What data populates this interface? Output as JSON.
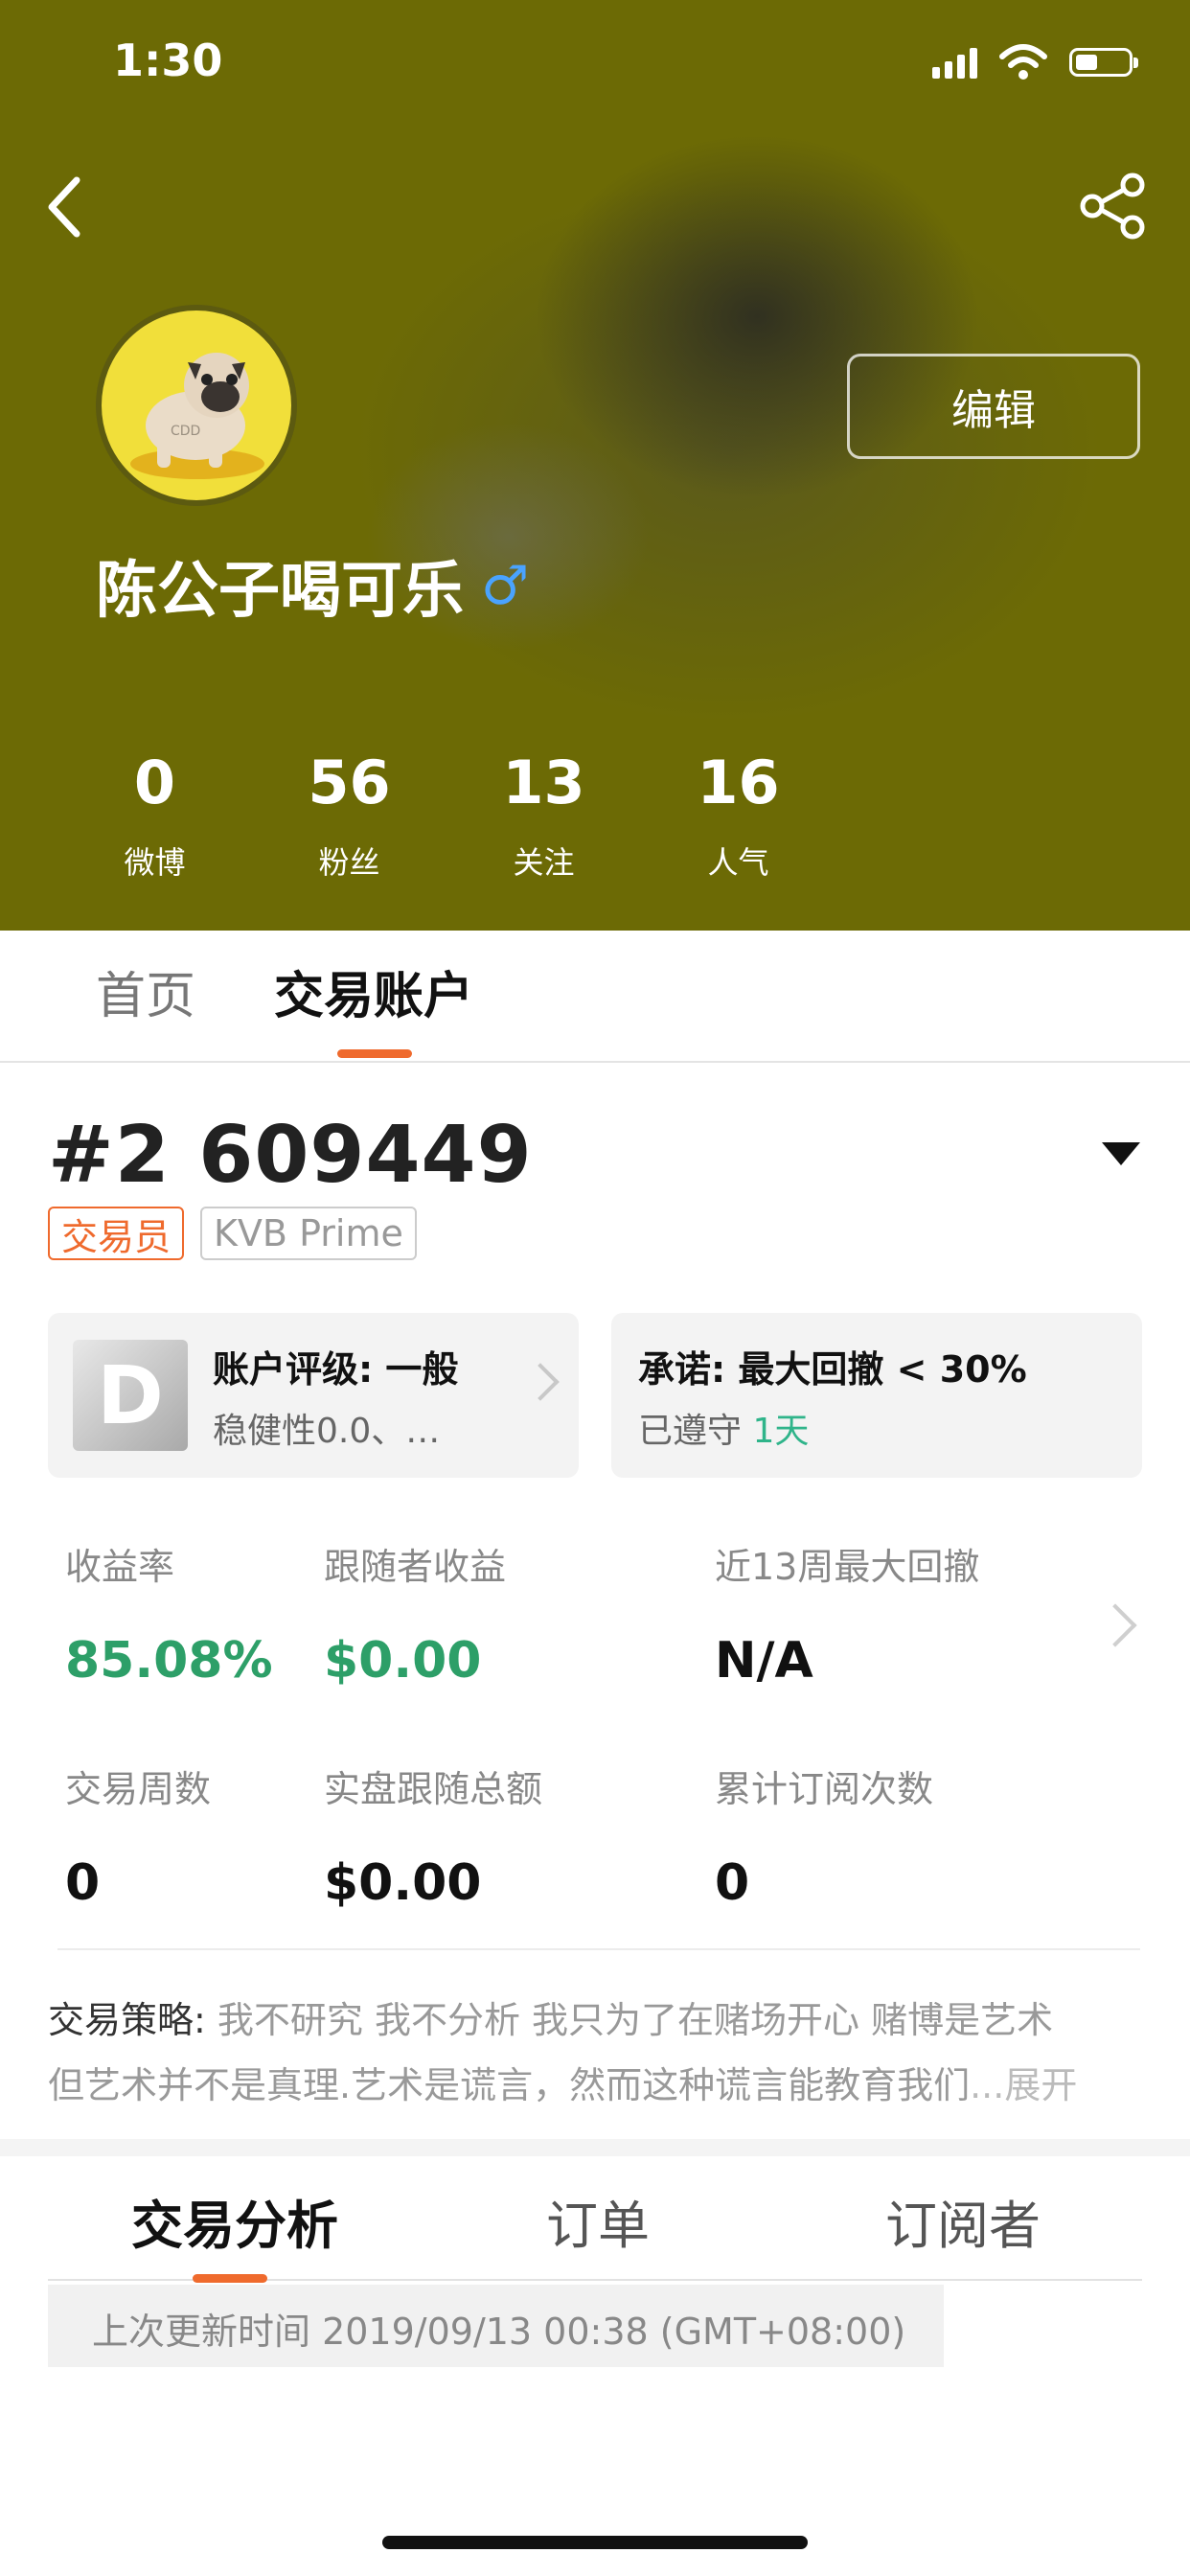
{
  "status_bar": {
    "time": "1:30"
  },
  "profile": {
    "name": "陈公子喝可乐",
    "gender_symbol": "♂",
    "edit_label": "编辑",
    "avatar_text": "CDD",
    "stats": [
      {
        "value": "0",
        "label": "微博"
      },
      {
        "value": "56",
        "label": "粉丝"
      },
      {
        "value": "13",
        "label": "关注"
      },
      {
        "value": "16",
        "label": "人气"
      }
    ]
  },
  "top_tabs": [
    {
      "label": "首页",
      "active": false
    },
    {
      "label": "交易账户",
      "active": true
    }
  ],
  "account": {
    "id": "#2 609449",
    "tags": [
      "交易员",
      "KVB Prime"
    ],
    "rating": {
      "grade": "D",
      "title": "账户评级: 一般",
      "subtitle": "稳健性0.0、…"
    },
    "promise": {
      "title": "承诺: 最大回撤 < 30%",
      "kept_prefix": "已遵守 ",
      "kept_days": "1天"
    },
    "metrics_row1": [
      {
        "label": "收益率",
        "value": "85.08%"
      },
      {
        "label": "跟随者收益",
        "value": "$0.00"
      },
      {
        "label": "近13周最大回撤",
        "value": "N/A"
      }
    ],
    "metrics_row2": [
      {
        "label": "交易周数",
        "value": "0"
      },
      {
        "label": "实盘跟随总额",
        "value": "$0.00"
      },
      {
        "label": "累计订阅次数",
        "value": "0"
      }
    ],
    "strategy": {
      "label": "交易策略: ",
      "line1": "我不研究 我不分析 我只为了在赌场开心 赌博是艺术",
      "line2": "但艺术并不是真理.艺术是谎言，然而这种谎言能教育我们",
      "expand": "...展开"
    }
  },
  "bottom_tabs": [
    {
      "label": "交易分析",
      "active": true
    },
    {
      "label": "订单",
      "active": false
    },
    {
      "label": "订阅者",
      "active": false
    }
  ],
  "last_update": "上次更新时间 2019/09/13 00:38 (GMT+08:00)",
  "colors": {
    "header_bg": "#6c6a05",
    "accent_orange": "#ef6a2d",
    "positive_green": "#2d9f68",
    "days_green": "#2fb48a",
    "gender_blue": "#4aa3ff"
  }
}
